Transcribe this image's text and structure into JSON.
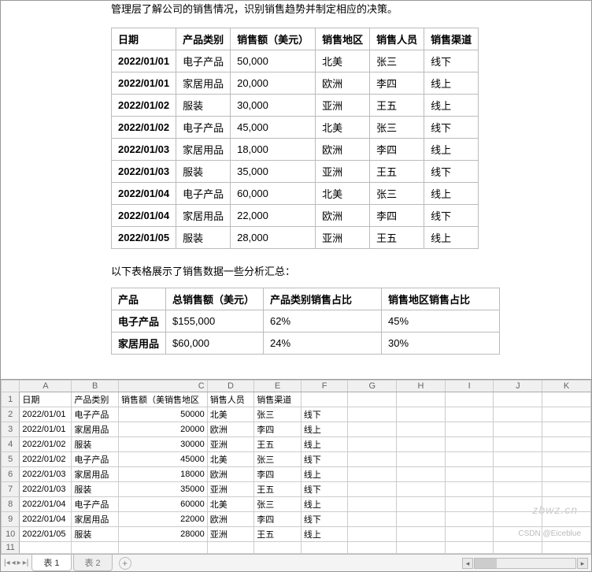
{
  "doc": {
    "intro": "管理层了解公司的销售情况，识别销售趋势并制定相应的决策。",
    "table1": {
      "headers": [
        "日期",
        "产品类别",
        "销售额（美元）",
        "销售地区",
        "销售人员",
        "销售渠道"
      ],
      "rows": [
        [
          "2022/01/01",
          "电子产品",
          "50,000",
          "北美",
          "张三",
          "线下"
        ],
        [
          "2022/01/01",
          "家居用品",
          "20,000",
          "欧洲",
          "李四",
          "线上"
        ],
        [
          "2022/01/02",
          "服装",
          "30,000",
          "亚洲",
          "王五",
          "线上"
        ],
        [
          "2022/01/02",
          "电子产品",
          "45,000",
          "北美",
          "张三",
          "线下"
        ],
        [
          "2022/01/03",
          "家居用品",
          "18,000",
          "欧洲",
          "李四",
          "线上"
        ],
        [
          "2022/01/03",
          "服装",
          "35,000",
          "亚洲",
          "王五",
          "线下"
        ],
        [
          "2022/01/04",
          "电子产品",
          "60,000",
          "北美",
          "张三",
          "线上"
        ],
        [
          "2022/01/04",
          "家居用品",
          "22,000",
          "欧洲",
          "李四",
          "线下"
        ],
        [
          "2022/01/05",
          "服装",
          "28,000",
          "亚洲",
          "王五",
          "线上"
        ]
      ]
    },
    "subtitle": "以下表格展示了销售数据一些分析汇总：",
    "table2": {
      "headers": [
        "产品",
        "总销售额（美元）",
        "产品类别销售占比",
        "销售地区销售占比"
      ],
      "rows": [
        [
          "电子产品",
          "$155,000",
          "62%",
          "45%"
        ],
        [
          "家居用品",
          "$60,000",
          "24%",
          "30%"
        ]
      ]
    }
  },
  "sheet": {
    "cols": [
      "A",
      "B",
      "C",
      "D",
      "E",
      "F",
      "G",
      "H",
      "I",
      "J",
      "K"
    ],
    "rows": [
      [
        "日期",
        "产品类别",
        "销售额（美销售地区",
        "销售人员",
        "销售渠道",
        "",
        "",
        "",
        "",
        "",
        ""
      ],
      [
        "2022/01/01",
        "电子产品",
        "50000",
        "北美",
        "张三",
        "线下",
        "",
        "",
        "",
        "",
        ""
      ],
      [
        "2022/01/01",
        "家居用品",
        "20000",
        "欧洲",
        "李四",
        "线上",
        "",
        "",
        "",
        "",
        ""
      ],
      [
        "2022/01/02",
        "服装",
        "30000",
        "亚洲",
        "王五",
        "线上",
        "",
        "",
        "",
        "",
        ""
      ],
      [
        "2022/01/02",
        "电子产品",
        "45000",
        "北美",
        "张三",
        "线下",
        "",
        "",
        "",
        "",
        ""
      ],
      [
        "2022/01/03",
        "家居用品",
        "18000",
        "欧洲",
        "李四",
        "线上",
        "",
        "",
        "",
        "",
        ""
      ],
      [
        "2022/01/03",
        "服装",
        "35000",
        "亚洲",
        "王五",
        "线下",
        "",
        "",
        "",
        "",
        ""
      ],
      [
        "2022/01/04",
        "电子产品",
        "60000",
        "北美",
        "张三",
        "线上",
        "",
        "",
        "",
        "",
        ""
      ],
      [
        "2022/01/04",
        "家居用品",
        "22000",
        "欧洲",
        "李四",
        "线下",
        "",
        "",
        "",
        "",
        ""
      ],
      [
        "2022/01/05",
        "服装",
        "28000",
        "亚洲",
        "王五",
        "线上",
        "",
        "",
        "",
        "",
        ""
      ],
      [
        "",
        "",
        "",
        "",
        "",
        "",
        "",
        "",
        "",
        "",
        ""
      ]
    ],
    "tabs": {
      "active": "表 1",
      "inactive": "表 2"
    }
  },
  "watermark1": "zbwz.cn",
  "watermark2": "CSDN @Eiceblue"
}
